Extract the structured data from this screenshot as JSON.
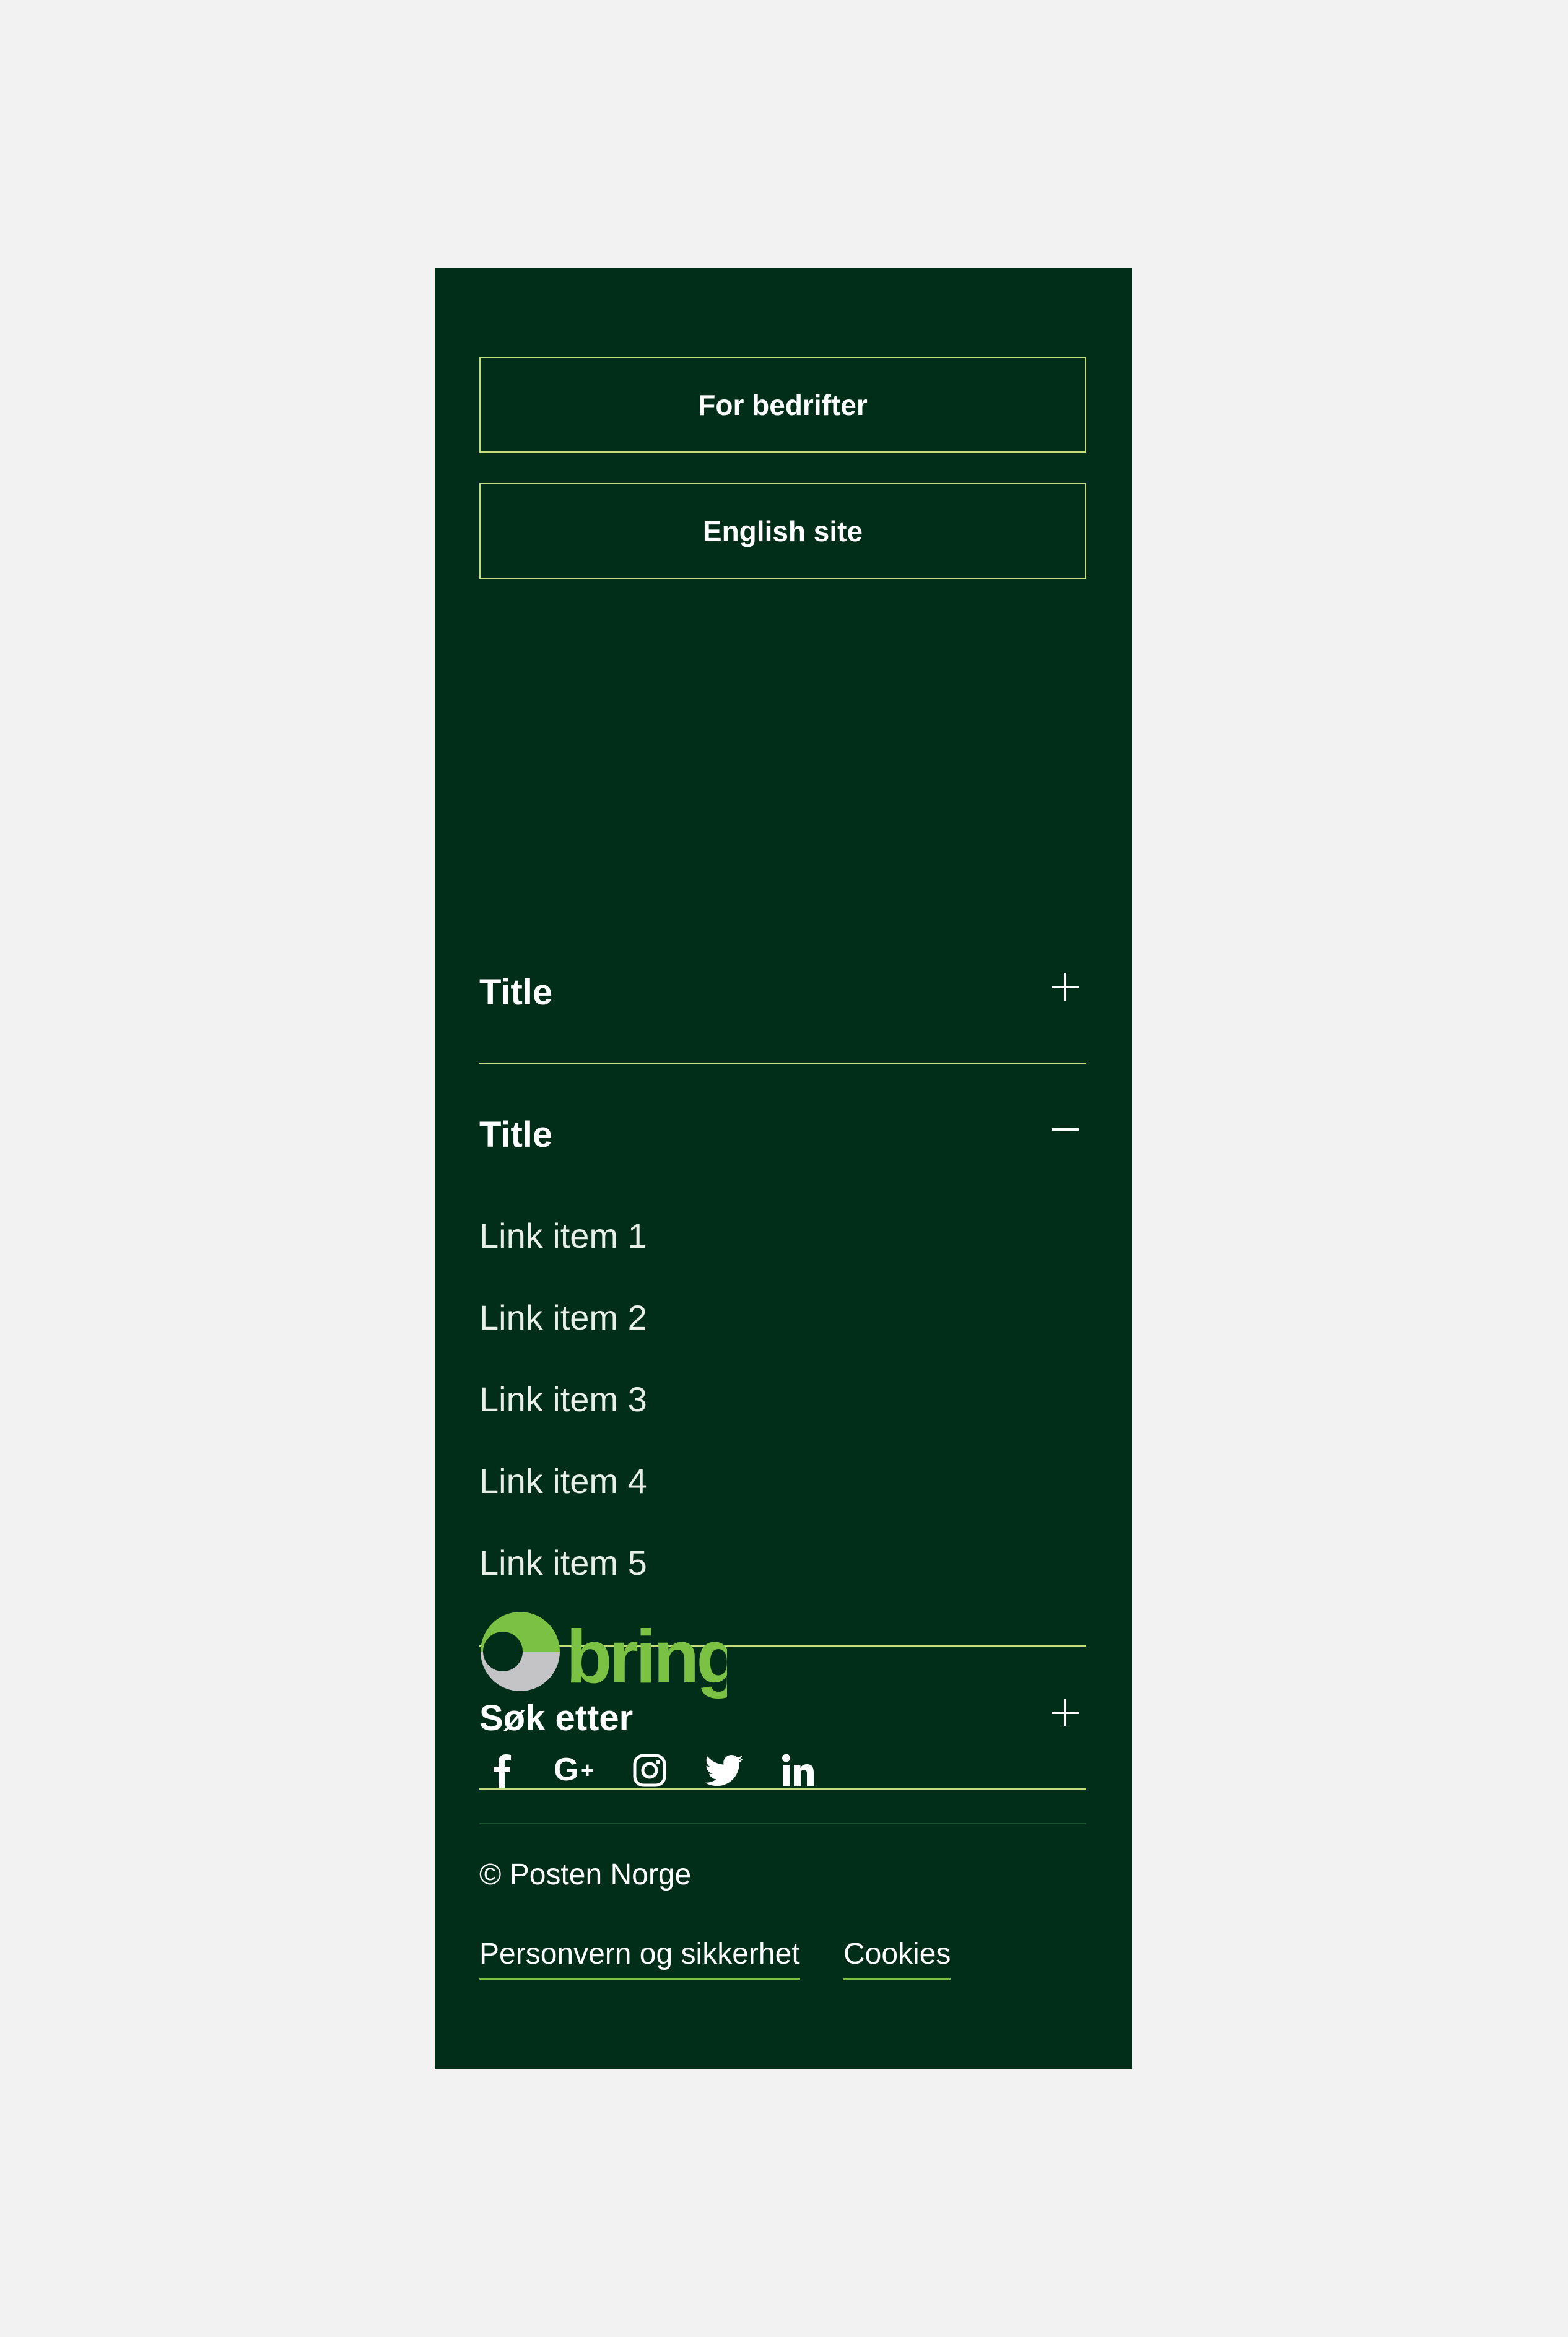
{
  "buttons": {
    "business": "For bedrifter",
    "english": "English site"
  },
  "accordions": [
    {
      "title": "Title",
      "expanded": false
    },
    {
      "title": "Title",
      "expanded": true,
      "links": [
        "Link item 1",
        "Link item 2",
        "Link item 3",
        "Link item 4",
        "Link item 5"
      ]
    },
    {
      "title": "Søk etter",
      "expanded": false
    }
  ],
  "logo": {
    "text": "bring"
  },
  "social": [
    "facebook-icon",
    "google-plus-icon",
    "instagram-icon",
    "twitter-icon",
    "linkedin-icon"
  ],
  "copyright": "© Posten Norge",
  "legal_links": [
    "Personvern og sikkerhet",
    "Cookies"
  ],
  "colors": {
    "page_background": "#f2f2f2",
    "footer_background": "#002e19",
    "accent_border": "#c3dd7c",
    "brand_green": "#7bc144",
    "logo_gray": "#c4c4c6",
    "text": "#ffffff"
  }
}
